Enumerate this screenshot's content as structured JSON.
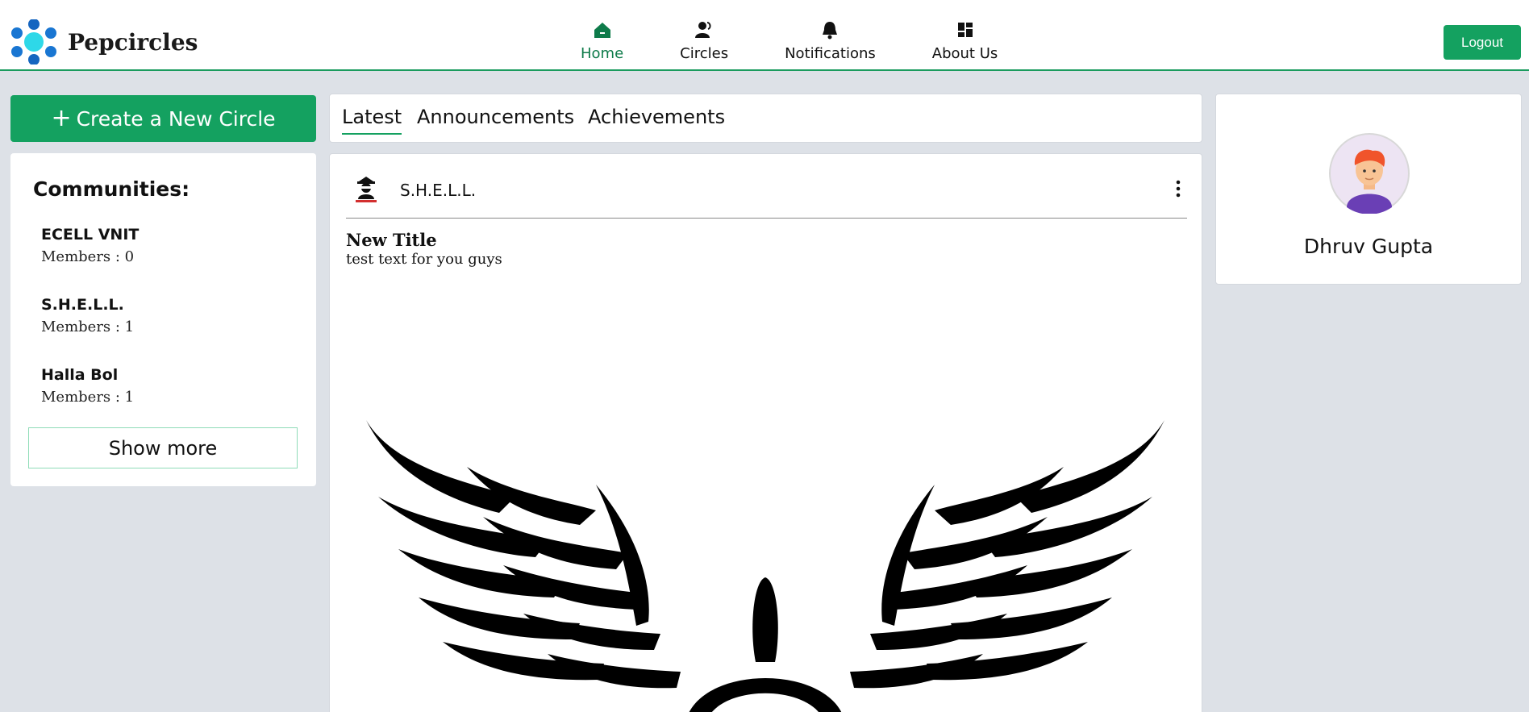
{
  "brand": {
    "name": "Pepcircles",
    "logo_icon": "molecule-logo-icon",
    "accent": "#1a9b5e"
  },
  "nav": {
    "items": [
      {
        "label": "Home",
        "icon": "home-icon",
        "active": true
      },
      {
        "label": "Circles",
        "icon": "users-icon",
        "active": false
      },
      {
        "label": "Notifications",
        "icon": "bell-icon",
        "active": false
      },
      {
        "label": "About Us",
        "icon": "dashboard-icon",
        "active": false
      }
    ],
    "logout_label": "Logout"
  },
  "sidebar": {
    "create_label": "Create a New Circle",
    "create_icon": "plus-icon",
    "communities_heading": "Communities:",
    "communities": [
      {
        "name": "ECELL VNIT",
        "members": "Members : 0"
      },
      {
        "name": "S.H.E.L.L.",
        "members": "Members : 1"
      },
      {
        "name": "Halla Bol",
        "members": "Members : 1"
      }
    ],
    "show_more_label": "Show more"
  },
  "feed": {
    "tabs": [
      {
        "label": "Latest",
        "active": true
      },
      {
        "label": "Announcements",
        "active": false
      },
      {
        "label": "Achievements",
        "active": false
      }
    ],
    "post": {
      "author": "S.H.E.L.L.",
      "title": "New Title",
      "text": "test text for you guys",
      "image": "winged-emblem-image",
      "menu_icon": "kebab-menu-icon"
    }
  },
  "profile": {
    "name": "Dhruv Gupta",
    "avatar": "user-avatar-icon"
  },
  "colors": {
    "primary": "#14a160",
    "active_nav": "#0e7b4a",
    "background": "#dde1e7"
  }
}
